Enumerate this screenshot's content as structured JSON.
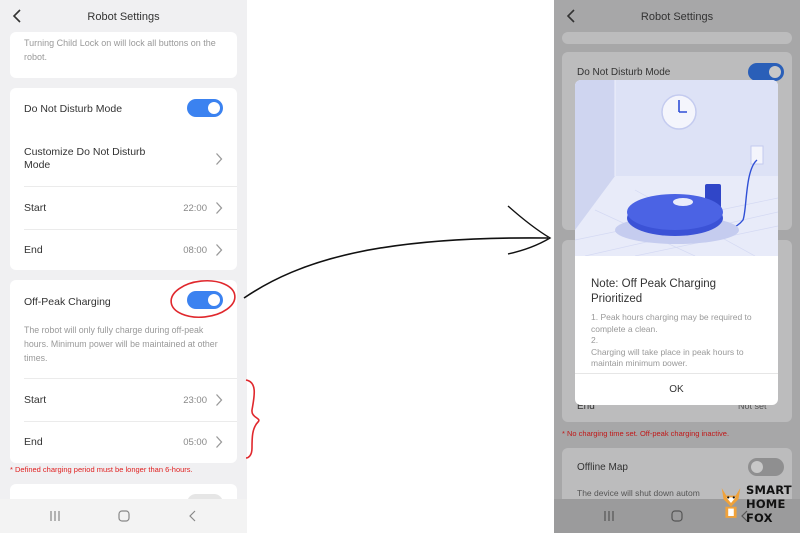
{
  "left": {
    "header_title": "Robot Settings",
    "child_lock_text": "Turning Child Lock on will lock all buttons on the robot.",
    "dnd": {
      "label": "Do Not Disturb Mode",
      "enabled": true,
      "customize_label": "Customize Do Not Disturb Mode",
      "start_label": "Start",
      "start_value": "22:00",
      "end_label": "End",
      "end_value": "08:00"
    },
    "off_peak": {
      "label": "Off-Peak Charging",
      "enabled": true,
      "description": "The robot will only fully charge during off-peak hours. Minimum power will be maintained at other times.",
      "start_label": "Start",
      "start_value": "23:00",
      "end_label": "End",
      "end_value": "05:00"
    },
    "warning": "* Defined charging period must be longer than 6-hours."
  },
  "right": {
    "header_title": "Robot Settings",
    "dnd_label": "Do Not Disturb Mode",
    "end_label": "End",
    "end_value": "Not set",
    "warning": "* No charging time set. Off-peak charging inactive.",
    "offline_map_label": "Offline Map",
    "offline_map_desc": "The device will shut down autom",
    "modal": {
      "title": "Note: Off Peak Charging Prioritized",
      "body_1": "1. Peak hours charging may be required to complete a clean.",
      "body_2": "2.",
      "body_3": "Charging will take place in peak hours to maintain minimum power.",
      "ok_label": "OK"
    }
  },
  "logo": {
    "line1": "SMART",
    "line2": "HOME",
    "line3": "FOX"
  },
  "colors": {
    "accent_blue": "#3b82f0",
    "warning_red": "#e02020",
    "annotation_red": "#e0282d"
  }
}
